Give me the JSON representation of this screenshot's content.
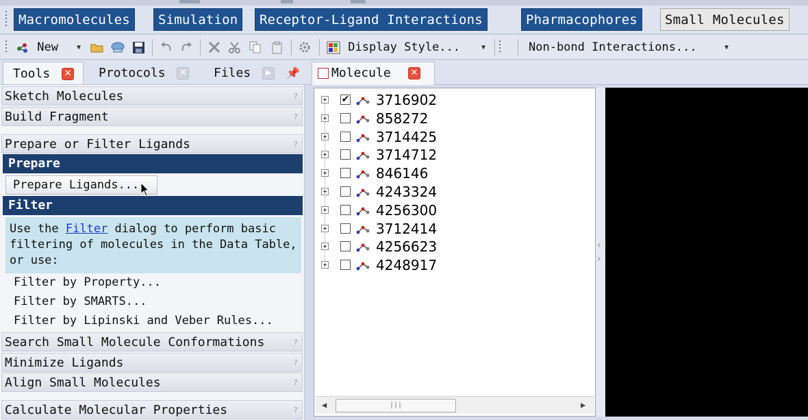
{
  "ribbon": {
    "tabs": [
      {
        "label": "Macromolecules",
        "active": false
      },
      {
        "label": "Simulation",
        "active": false
      },
      {
        "label": "Receptor-Ligand Interactions",
        "active": false
      },
      {
        "label": "Pharmacophores",
        "active": false
      },
      {
        "label": "Small Molecules",
        "active": true
      }
    ]
  },
  "toolbar": {
    "new_label": "New",
    "display_style_label": "Display Style...",
    "nonbond_label": "Non-bond Interactions..."
  },
  "left_tabs": {
    "tools": "Tools",
    "protocols": "Protocols",
    "files": "Files"
  },
  "tools": {
    "sketch": "Sketch Molecules",
    "build_fragment": "Build Fragment",
    "prepare_filter": "Prepare or Filter Ligands",
    "prepare_head": "Prepare",
    "prepare_button": "Prepare Ligands...",
    "filter_head": "Filter",
    "info_pre": "Use the ",
    "info_link": "Filter",
    "info_post": " dialog to perform basic filtering of molecules in the Data Table, or use:",
    "filter_property": "Filter by Property...",
    "filter_smarts": "Filter by SMARTS...",
    "filter_lipinski": "Filter by Lipinski and Veber Rules...",
    "search_conf": "Search Small Molecule Conformations",
    "minimize": "Minimize Ligands",
    "align": "Align Small Molecules",
    "calc_props": "Calculate Molecular Properties"
  },
  "molecule_tab": {
    "label": "Molecule"
  },
  "molecules": [
    {
      "id": "3716902",
      "checked": true
    },
    {
      "id": "858272",
      "checked": false
    },
    {
      "id": "3714425",
      "checked": false
    },
    {
      "id": "3714712",
      "checked": false
    },
    {
      "id": "846146",
      "checked": false
    },
    {
      "id": "4243324",
      "checked": false
    },
    {
      "id": "4256300",
      "checked": false
    },
    {
      "id": "3712414",
      "checked": false
    },
    {
      "id": "4256623",
      "checked": false
    },
    {
      "id": "4248917",
      "checked": false
    }
  ],
  "colors": {
    "ribbon_tab": "#1f5290",
    "section_head": "#1d3f6e",
    "info_bg": "#c9e4ee",
    "close_red": "#e8503a"
  }
}
